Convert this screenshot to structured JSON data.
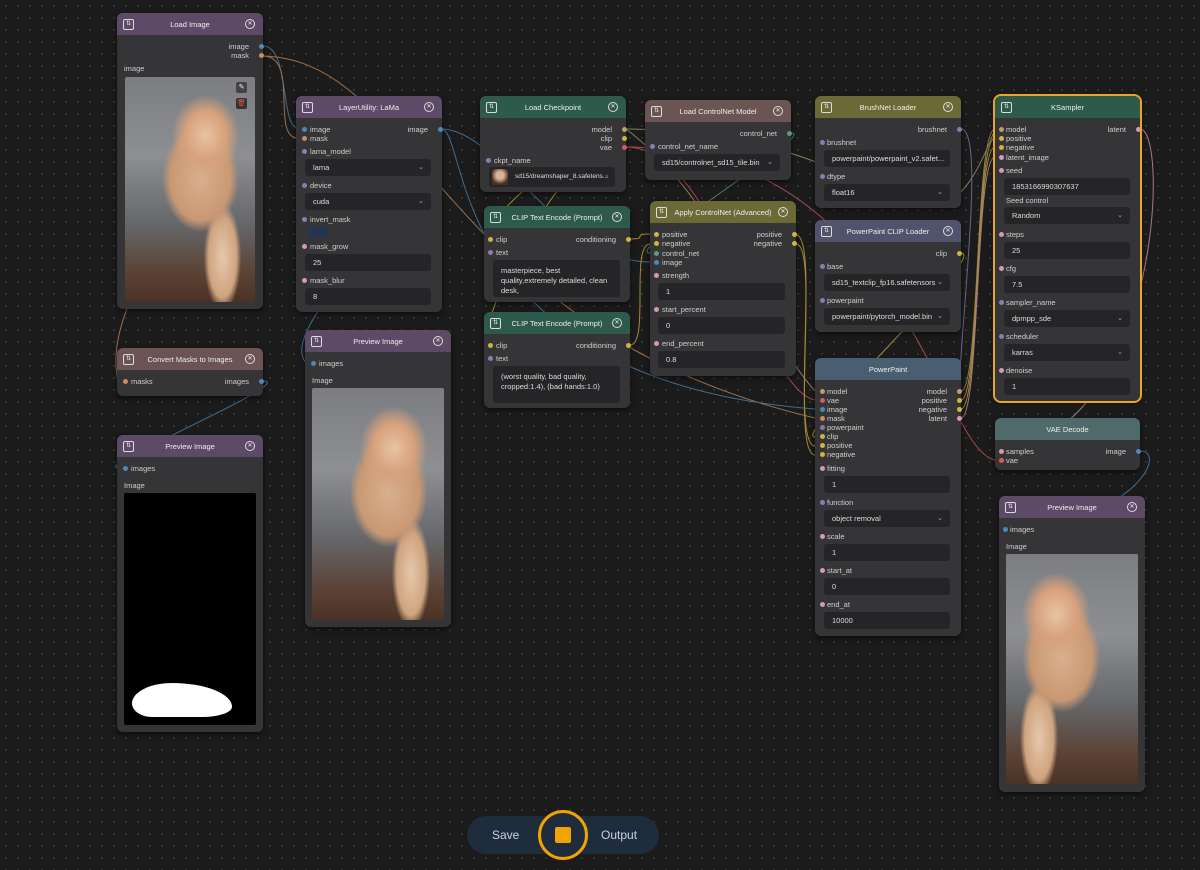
{
  "toolbar": {
    "save_label": "Save",
    "output_label": "Output"
  },
  "nodes": {
    "load_image": {
      "title": "Load Image",
      "out_image": "image",
      "out_mask": "mask",
      "preview_label": "image"
    },
    "lama": {
      "title": "LayerUtility: LaMa",
      "in_image": "image",
      "in_mask": "mask",
      "out_image": "image",
      "lama_model_label": "lama_model",
      "lama_model_value": "lama",
      "device_label": "device",
      "device_value": "cuda",
      "invert_mask_label": "invert_mask",
      "mask_grow_label": "mask_grow",
      "mask_grow_value": "25",
      "mask_blur_label": "mask_blur",
      "mask_blur_value": "8"
    },
    "convert_masks": {
      "title": "Convert Masks to Images",
      "in_masks": "masks",
      "out_images": "images"
    },
    "preview_mask": {
      "title": "Preview Image",
      "in_images": "images",
      "image_label": "Image"
    },
    "preview_lama": {
      "title": "Preview Image",
      "in_images": "images",
      "image_label": "Image"
    },
    "load_checkpoint": {
      "title": "Load Checkpoint",
      "out_model": "model",
      "out_clip": "clip",
      "out_vae": "vae",
      "ckpt_label": "ckpt_name",
      "ckpt_value": "sd15/dreamshaper_8.safetens..."
    },
    "clip_pos": {
      "title": "CLIP Text Encode (Prompt)",
      "in_clip": "clip",
      "in_text": "text",
      "out_conditioning": "conditioning",
      "text_value": "masterpiece, best quality,extremely detailed, clean desk,"
    },
    "clip_neg": {
      "title": "CLIP Text Encode (Prompt)",
      "in_clip": "clip",
      "in_text": "text",
      "out_conditioning": "conditioning",
      "text_value": "(worst quality, bad quality, cropped:1.4), (bad hands:1.0)"
    },
    "load_controlnet": {
      "title": "Load ControlNet Model",
      "out_control_net": "control_net",
      "name_label": "control_net_name",
      "name_value": "sd15/controlnet_sd15_tile.bin"
    },
    "apply_controlnet": {
      "title": "Apply ControlNet (Advanced)",
      "in_positive": "positive",
      "in_negative": "negative",
      "in_control_net": "control_net",
      "in_image": "image",
      "out_positive": "positive",
      "out_negative": "negative",
      "strength_label": "strength",
      "strength_value": "1",
      "start_label": "start_percent",
      "start_value": "0",
      "end_label": "end_percent",
      "end_value": "0.8"
    },
    "brushnet_loader": {
      "title": "BrushNet Loader",
      "out_brushnet": "brushnet",
      "brushnet_label": "brushnet",
      "brushnet_value": "powerpaint/powerpaint_v2.safet...",
      "dtype_label": "dtype",
      "dtype_value": "float16"
    },
    "pp_clip_loader": {
      "title": "PowerPaint CLIP Loader",
      "out_clip": "clip",
      "base_label": "base",
      "base_value": "sd15_textclip_fp16.safetensors",
      "powerpaint_label": "powerpaint",
      "powerpaint_value": "powerpaint/pytorch_model.bin"
    },
    "powerpaint": {
      "title": "PowerPaint",
      "inputs": [
        "model",
        "vae",
        "image",
        "mask",
        "powerpaint",
        "clip",
        "positive",
        "negative"
      ],
      "outputs": [
        "model",
        "positive",
        "negative",
        "latent"
      ],
      "fitting_label": "fitting",
      "fitting_value": "1",
      "function_label": "function",
      "function_value": "object removal",
      "scale_label": "scale",
      "scale_value": "1",
      "start_at_label": "start_at",
      "start_at_value": "0",
      "end_at_label": "end_at",
      "end_at_value": "10000"
    },
    "ksampler": {
      "title": "KSampler",
      "inputs": [
        "model",
        "positive",
        "negative",
        "latent_image"
      ],
      "out_latent": "latent",
      "seed_label": "seed",
      "seed_value": "1853166990307637",
      "seed_control_label": "Seed control",
      "seed_control_value": "Random",
      "steps_label": "steps",
      "steps_value": "25",
      "cfg_label": "cfg",
      "cfg_value": "7.5",
      "sampler_label": "sampler_name",
      "sampler_value": "dpmpp_sde",
      "scheduler_label": "scheduler",
      "scheduler_value": "karras",
      "denoise_label": "denoise",
      "denoise_value": "1"
    },
    "vae_decode": {
      "title": "VAE Decode",
      "in_samples": "samples",
      "in_vae": "vae",
      "out_image": "image"
    },
    "preview_final": {
      "title": "Preview Image",
      "in_images": "images",
      "image_label": "Image"
    }
  },
  "colors": {
    "header_purple": "#5d4a66",
    "header_green": "#2d5a4a",
    "header_brown": "#6b5454",
    "header_olive": "#6b6a36",
    "header_slate": "#50536b",
    "header_steel": "#4a5e72",
    "header_teal": "#4e6a6a",
    "selection": "#e8a624",
    "run_accent": "#f0a400"
  },
  "icons": [
    "node-icon",
    "close-icon",
    "edit-icon",
    "delete-icon",
    "chevron-down-icon",
    "chevron-right-icon",
    "stop-icon"
  ]
}
